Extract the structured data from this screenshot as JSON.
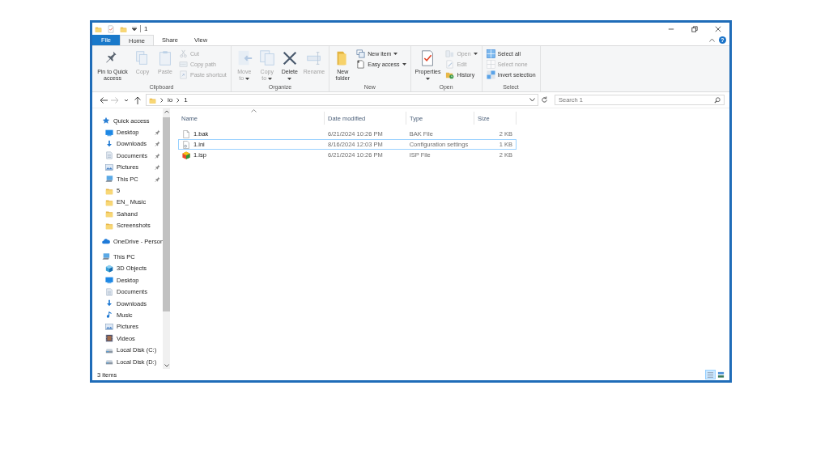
{
  "title_bar": {
    "title": "1"
  },
  "ribbon": {
    "tabs": [
      {
        "label": "File",
        "kind": "file",
        "selected": false
      },
      {
        "label": "Home",
        "kind": "tab",
        "selected": true
      },
      {
        "label": "Share",
        "kind": "tab",
        "selected": false
      },
      {
        "label": "View",
        "kind": "tab",
        "selected": false
      }
    ],
    "help_label": "?",
    "groups": [
      {
        "label": "Clipboard",
        "commands": [
          {
            "label": "Pin to Quick access",
            "kind": "large",
            "disabled": false,
            "dropdown": false
          },
          {
            "label": "Copy",
            "kind": "large",
            "disabled": true,
            "dropdown": false
          },
          {
            "label": "Paste",
            "kind": "large",
            "disabled": true,
            "dropdown": false
          },
          {
            "label": "Cut",
            "kind": "small",
            "disabled": true,
            "dropdown": false
          },
          {
            "label": "Copy path",
            "kind": "small",
            "disabled": true,
            "dropdown": false
          },
          {
            "label": "Paste shortcut",
            "kind": "small",
            "disabled": true,
            "dropdown": false
          }
        ]
      },
      {
        "label": "Organize",
        "commands": [
          {
            "label": "Move to",
            "kind": "large",
            "disabled": true,
            "dropdown": true
          },
          {
            "label": "Copy to",
            "kind": "large",
            "disabled": true,
            "dropdown": true
          },
          {
            "label": "Delete",
            "kind": "large",
            "disabled": false,
            "dropdown": true
          },
          {
            "label": "Rename",
            "kind": "large",
            "disabled": true,
            "dropdown": false
          }
        ]
      },
      {
        "label": "New",
        "commands": [
          {
            "label": "New folder",
            "kind": "large",
            "disabled": false,
            "dropdown": false
          },
          {
            "label": "New item",
            "kind": "small",
            "disabled": false,
            "dropdown": true
          },
          {
            "label": "Easy access",
            "kind": "small",
            "disabled": false,
            "dropdown": true
          }
        ]
      },
      {
        "label": "Open",
        "commands": [
          {
            "label": "Properties",
            "kind": "large",
            "disabled": false,
            "dropdown": true
          },
          {
            "label": "Open",
            "kind": "small",
            "disabled": true,
            "dropdown": true
          },
          {
            "label": "Edit",
            "kind": "small",
            "disabled": true,
            "dropdown": false
          },
          {
            "label": "History",
            "kind": "small",
            "disabled": false,
            "dropdown": false
          }
        ]
      },
      {
        "label": "Select",
        "commands": [
          {
            "label": "Select all",
            "kind": "small",
            "disabled": false,
            "dropdown": false
          },
          {
            "label": "Select none",
            "kind": "small",
            "disabled": true,
            "dropdown": false
          },
          {
            "label": "Invert selection",
            "kind": "small",
            "disabled": false,
            "dropdown": false
          }
        ]
      }
    ]
  },
  "address_bar": {
    "nav_buttons": [
      {
        "kind": "back",
        "disabled": false
      },
      {
        "kind": "forward",
        "disabled": true
      },
      {
        "kind": "recent",
        "disabled": false
      },
      {
        "kind": "up",
        "disabled": false
      }
    ],
    "segments": [
      "io",
      "1"
    ]
  },
  "search": {
    "placeholder": "Search 1"
  },
  "navigation_pane": {
    "items": [
      {
        "label": "Quick access",
        "kind": "star",
        "children": [
          {
            "label": "Desktop",
            "kind": "desktop",
            "pinned": true
          },
          {
            "label": "Downloads",
            "kind": "downloads",
            "pinned": true
          },
          {
            "label": "Documents",
            "kind": "documents",
            "pinned": true
          },
          {
            "label": "Pictures",
            "kind": "pictures",
            "pinned": true
          },
          {
            "label": "This PC",
            "kind": "pc",
            "pinned": true
          },
          {
            "label": "5",
            "kind": "folder",
            "pinned": false
          },
          {
            "label": "EN_ Music",
            "kind": "folder",
            "pinned": false
          },
          {
            "label": "Sahand",
            "kind": "folder",
            "pinned": false
          },
          {
            "label": "Screenshots",
            "kind": "folder",
            "pinned": false
          }
        ]
      },
      {
        "label": "OneDrive - Person",
        "kind": "cloud"
      },
      {
        "label": "This PC",
        "kind": "pc",
        "children": [
          {
            "label": "3D Objects",
            "kind": "cube"
          },
          {
            "label": "Desktop",
            "kind": "desktop"
          },
          {
            "label": "Documents",
            "kind": "documents"
          },
          {
            "label": "Downloads",
            "kind": "downloads"
          },
          {
            "label": "Music",
            "kind": "music"
          },
          {
            "label": "Pictures",
            "kind": "pictures"
          },
          {
            "label": "Videos",
            "kind": "videos"
          },
          {
            "label": "Local Disk (C:)",
            "kind": "drive"
          },
          {
            "label": "Local Disk (D:)",
            "kind": "drive"
          }
        ]
      }
    ]
  },
  "file_list": {
    "columns": [
      {
        "label": "Name",
        "sorted": true
      },
      {
        "label": "Date modified",
        "sorted": false
      },
      {
        "label": "Type",
        "sorted": false
      },
      {
        "label": "Size",
        "sorted": false
      }
    ],
    "rows": [
      {
        "kind": "blank",
        "name": "1.bak",
        "date": "6/21/2024 10:26 PM",
        "type": "BAK File",
        "size": "2 KB",
        "focused": false
      },
      {
        "kind": "settings",
        "name": "1.ini",
        "date": "8/16/2024 12:03 PM",
        "type": "Configuration settings",
        "size": "1 KB",
        "focused": true
      },
      {
        "kind": "cube",
        "name": "1.isp",
        "date": "6/21/2024 10:26 PM",
        "type": "ISP File",
        "size": "2 KB",
        "focused": false
      }
    ]
  },
  "status_bar": {
    "count": "3 items",
    "views": [
      {
        "kind": "details",
        "selected": true
      },
      {
        "kind": "tiles",
        "selected": false
      }
    ]
  }
}
